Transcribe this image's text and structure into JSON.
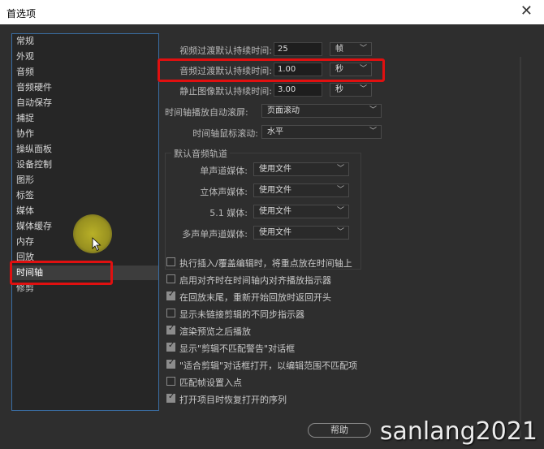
{
  "window": {
    "title": "首选项",
    "close": "✕"
  },
  "sidebar": {
    "items": [
      {
        "label": "常规"
      },
      {
        "label": "外观"
      },
      {
        "label": "音频"
      },
      {
        "label": "音频硬件"
      },
      {
        "label": "自动保存"
      },
      {
        "label": "捕捉"
      },
      {
        "label": "协作"
      },
      {
        "label": "操纵面板"
      },
      {
        "label": "设备控制"
      },
      {
        "label": "图形"
      },
      {
        "label": "标签"
      },
      {
        "label": "媒体"
      },
      {
        "label": "媒体缓存"
      },
      {
        "label": "内存"
      },
      {
        "label": "回放"
      },
      {
        "label": "时间轴"
      },
      {
        "label": "修剪"
      }
    ],
    "selected": "时间轴"
  },
  "settings": {
    "video_transition": {
      "label": "视频过渡默认持续时间:",
      "value": "25",
      "unit": "帧"
    },
    "audio_transition": {
      "label": "音频过渡默认持续时间:",
      "value": "1.00",
      "unit": "秒"
    },
    "still_image": {
      "label": "静止图像默认持续时间:",
      "value": "3.00",
      "unit": "秒"
    },
    "auto_scroll": {
      "label": "时间轴播放自动滚屏:",
      "value": "页面滚动"
    },
    "mouse_scroll": {
      "label": "时间轴鼠标滚动:",
      "value": "水平"
    }
  },
  "audio_tracks": {
    "title": "默认音频轨道",
    "mono": {
      "label": "单声道媒体:",
      "value": "使用文件"
    },
    "stereo": {
      "label": "立体声媒体:",
      "value": "使用文件"
    },
    "surround": {
      "label": "5.1 媒体:",
      "value": "使用文件"
    },
    "multi_mono": {
      "label": "多声单声道媒体:",
      "value": "使用文件"
    }
  },
  "checkboxes": [
    {
      "label": "执行插入/覆盖编辑时，将重点放在时间轴上",
      "checked": false
    },
    {
      "label": "启用对齐时在时间轴内对齐播放指示器",
      "checked": false
    },
    {
      "label": "在回放末尾，重新开始回放时返回开头",
      "checked": true
    },
    {
      "label": "显示未链接剪辑的不同步指示器",
      "checked": false
    },
    {
      "label": "渲染预览之后播放",
      "checked": true
    },
    {
      "label": "显示\"剪辑不匹配警告\"对话框",
      "checked": true
    },
    {
      "label": "\"适合剪辑\"对话框打开，以编辑范围不匹配项",
      "checked": true
    },
    {
      "label": "匹配帧设置入点",
      "checked": false
    },
    {
      "label": "打开项目时恢复打开的序列",
      "checked": true
    }
  ],
  "buttons": {
    "help": "帮助"
  },
  "watermark": "sanlang2021",
  "colors": {
    "highlight": "#e01010",
    "accent": "#3a6ea5"
  }
}
